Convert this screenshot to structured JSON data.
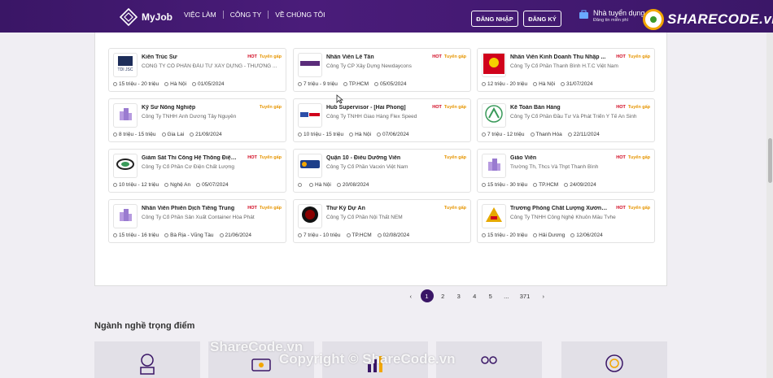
{
  "header": {
    "logo": "MyJob",
    "nav": [
      "VIỆC LÀM",
      "CÔNG TY",
      "VỀ CHÚNG TÔI"
    ],
    "login": "ĐĂNG NHẬP",
    "register": "ĐĂNG KÝ",
    "employer": {
      "title": "Nhà tuyển dụng",
      "subtitle": "Đăng tin miễn phí"
    },
    "brand": "SHARECODE.vn"
  },
  "jobs": [
    {
      "title": "Kiến Trúc Sư",
      "company": "CÔNG TY CỔ PHẦN ĐẦU TƯ XÂY DỰNG - THƯƠNG ...",
      "hot": "HOT",
      "urgent": "Tuyển gấp",
      "salary": "15 triệu - 20 triệu",
      "location": "Hà Nội",
      "date": "01/05/2024",
      "logo": "tdi-jsc-logo"
    },
    {
      "title": "Nhân Viên Lễ Tân",
      "company": "Công Ty CP Xây Dựng Newdaycons",
      "hot": "HOT",
      "urgent": "Tuyển gấp",
      "salary": "7 triệu - 9 triệu",
      "location": "TP.HCM",
      "date": "05/05/2024",
      "logo": "newdaycons-logo"
    },
    {
      "title": "Nhân Viên Kinh Doanh Thu Nhập ...",
      "company": "Công Ty Cổ Phần Thanh Bình H.T.C Việt Nam",
      "hot": "HOT",
      "urgent": "Tuyển gấp",
      "salary": "12 triệu - 20 triệu",
      "location": "Hà Nội",
      "date": "31/07/2024",
      "logo": "thanh-binh-logo"
    },
    {
      "title": "Kỹ Sư Nông Nghiệp",
      "company": "Công Ty TNHH Ánh Dương Tây Nguyên",
      "hot": "",
      "urgent": "Tuyển gấp",
      "salary": "8 triệu - 15 triệu",
      "location": "Gia Lai",
      "date": "21/09/2024",
      "logo": "building-logo"
    },
    {
      "title": "Hub Supervisor - [Hai Phong]",
      "company": "Công Ty TNHH Giao Hàng Flex Speed",
      "hot": "HOT",
      "urgent": "Tuyển gấp",
      "salary": "10 triệu - 15 triệu",
      "location": "Hà Nội",
      "date": "07/06/2024",
      "logo": "flex-speed-logo"
    },
    {
      "title": "Kế Toán Bán Hàng",
      "company": "Công Ty Cổ Phần Đầu Tư Và Phát Triển Y Tế An Sinh",
      "hot": "HOT",
      "urgent": "Tuyển gấp",
      "salary": "7 triệu - 12 triệu",
      "location": "Thanh Hóa",
      "date": "22/11/2024",
      "logo": "an-sinh-logo"
    },
    {
      "title": "Giám Sát Thi Công Hệ Thống Điện ...",
      "company": "Công Ty Cổ Phần Cơ Điện Chất Lượng",
      "hot": "HOT",
      "urgent": "Tuyển gấp",
      "salary": "10 triệu - 12 triệu",
      "location": "Nghệ An",
      "date": "05/07/2024",
      "logo": "co-dien-logo"
    },
    {
      "title": "Quận 10 - Điều Dưỡng Viên",
      "company": "Công Ty Cổ Phần Vacxin Việt Nam",
      "hot": "",
      "urgent": "Tuyển gấp",
      "salary": "",
      "location": "Hà Nội",
      "date": "20/08/2024",
      "logo": "vnvc-logo"
    },
    {
      "title": "Giáo Viên",
      "company": "Trường Th, Thcs Và Thpt Thanh Bình",
      "hot": "HOT",
      "urgent": "Tuyển gấp",
      "salary": "15 triệu - 30 triệu",
      "location": "TP.HCM",
      "date": "24/09/2024",
      "logo": "building-logo"
    },
    {
      "title": "Nhân Viên Phiên Dịch Tiếng Trung",
      "company": "Công Ty Cổ Phần Sản Xuất Container Hòa Phát",
      "hot": "HOT",
      "urgent": "Tuyển gấp",
      "salary": "15 triệu - 16 triệu",
      "location": "Bà Rịa - Vũng Tàu",
      "date": "21/06/2024",
      "logo": "building-logo"
    },
    {
      "title": "Thư Ký Dự Án",
      "company": "Công Ty Cổ Phần Nội Thất NEM",
      "hot": "",
      "urgent": "Tuyển gấp",
      "salary": "7 triệu - 10 triệu",
      "location": "TP.HCM",
      "date": "02/08/2024",
      "logo": "nem-logo"
    },
    {
      "title": "Trưởng Phòng Chất Lượng Xưởng Nhựa",
      "company": "Công Ty TNHH Công Nghệ Khuôn Mẫu Tvhe",
      "hot": "HOT",
      "urgent": "Tuyển gấp",
      "salary": "15 triệu - 20 triệu",
      "location": "Hải Dương",
      "date": "12/06/2024",
      "logo": "tvhe-logo"
    }
  ],
  "pagination": {
    "prev": "‹",
    "pages": [
      "1",
      "2",
      "3",
      "4",
      "5",
      "...",
      "371"
    ],
    "next": "›",
    "current": "1"
  },
  "section": {
    "title": "Ngành nghề trọng điểm"
  },
  "watermark": {
    "line1": "ShareCode.vn",
    "line2": "Copyright © ShareCode.vn"
  },
  "colors": {
    "primary": "#3a1666",
    "hot": "#d0021b",
    "urgent": "#e69500"
  }
}
